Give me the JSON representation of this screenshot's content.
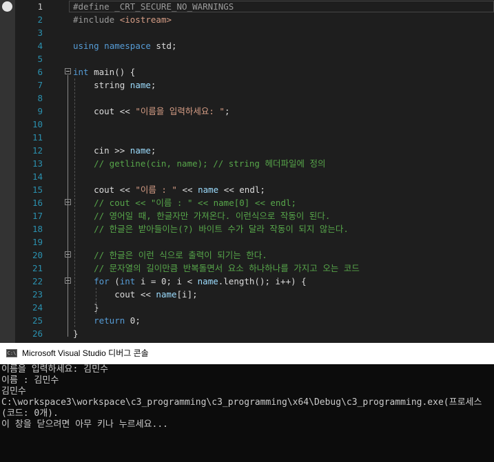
{
  "editor": {
    "lines": [
      {
        "num": "1",
        "segments": [
          {
            "t": "#define _CRT_SECURE_NO_WARNINGS",
            "c": "pp"
          }
        ]
      },
      {
        "num": "2",
        "segments": [
          {
            "t": "#include ",
            "c": "pp"
          },
          {
            "t": "<iostream>",
            "c": "str"
          }
        ]
      },
      {
        "num": "3",
        "segments": []
      },
      {
        "num": "4",
        "segments": [
          {
            "t": "using",
            "c": "kw"
          },
          {
            "t": " ",
            "c": ""
          },
          {
            "t": "namespace",
            "c": "kw"
          },
          {
            "t": " std;",
            "c": ""
          }
        ]
      },
      {
        "num": "5",
        "segments": []
      },
      {
        "num": "6",
        "segments": [
          {
            "t": "int",
            "c": "kw"
          },
          {
            "t": " main() {",
            "c": ""
          }
        ]
      },
      {
        "num": "7",
        "segments": [
          {
            "t": "    string ",
            "c": "id"
          },
          {
            "t": "name",
            "c": "var"
          },
          {
            "t": ";",
            "c": ""
          }
        ]
      },
      {
        "num": "8",
        "segments": []
      },
      {
        "num": "9",
        "segments": [
          {
            "t": "    cout << ",
            "c": ""
          },
          {
            "t": "\"이름을 입력하세요: \"",
            "c": "str"
          },
          {
            "t": ";",
            "c": ""
          }
        ]
      },
      {
        "num": "10",
        "segments": []
      },
      {
        "num": "11",
        "segments": []
      },
      {
        "num": "12",
        "segments": [
          {
            "t": "    cin >> ",
            "c": ""
          },
          {
            "t": "name",
            "c": "var"
          },
          {
            "t": ";",
            "c": ""
          }
        ]
      },
      {
        "num": "13",
        "segments": [
          {
            "t": "    // getline(cin, name); // string 헤더파일에 정의",
            "c": "cm"
          }
        ]
      },
      {
        "num": "14",
        "segments": []
      },
      {
        "num": "15",
        "segments": [
          {
            "t": "    cout << ",
            "c": ""
          },
          {
            "t": "\"이름 : \"",
            "c": "str"
          },
          {
            "t": " << ",
            "c": ""
          },
          {
            "t": "name",
            "c": "var"
          },
          {
            "t": " << endl;",
            "c": ""
          }
        ]
      },
      {
        "num": "16",
        "segments": [
          {
            "t": "    // cout << \"이름 : \" << name[0] << endl;",
            "c": "cm"
          }
        ]
      },
      {
        "num": "17",
        "segments": [
          {
            "t": "    // 영어일 때, 한글자만 가져온다. 이런식으로 작동이 된다.",
            "c": "cm"
          }
        ]
      },
      {
        "num": "18",
        "segments": [
          {
            "t": "    // 한글은 받아들이는(?) 바이트 수가 달라 작동이 되지 않는다.",
            "c": "cm"
          }
        ]
      },
      {
        "num": "19",
        "segments": []
      },
      {
        "num": "20",
        "segments": [
          {
            "t": "    // 한글은 이런 식으로 출력이 되기는 한다.",
            "c": "cm"
          }
        ]
      },
      {
        "num": "21",
        "segments": [
          {
            "t": "    // 문자열의 길이만큼 반복돌면서 요소 하나하나를 가지고 오는 코드",
            "c": "cm"
          }
        ]
      },
      {
        "num": "22",
        "segments": [
          {
            "t": "    for",
            "c": "kw"
          },
          {
            "t": " (",
            "c": ""
          },
          {
            "t": "int",
            "c": "kw"
          },
          {
            "t": " i = 0; i < ",
            "c": ""
          },
          {
            "t": "name",
            "c": "var"
          },
          {
            "t": ".length(); i++) {",
            "c": ""
          }
        ]
      },
      {
        "num": "23",
        "segments": [
          {
            "t": "        cout << ",
            "c": ""
          },
          {
            "t": "name",
            "c": "var"
          },
          {
            "t": "[i];",
            "c": ""
          }
        ]
      },
      {
        "num": "24",
        "segments": [
          {
            "t": "    }",
            "c": ""
          }
        ]
      },
      {
        "num": "25",
        "segments": [
          {
            "t": "    return",
            "c": "kw"
          },
          {
            "t": " 0;",
            "c": ""
          }
        ]
      },
      {
        "num": "26",
        "segments": [
          {
            "t": "}",
            "c": ""
          }
        ]
      }
    ]
  },
  "console": {
    "title": "Microsoft Visual Studio 디버그 콘솔",
    "icon": "console-app-icon",
    "icon_text": "C:\\",
    "lines": [
      "이름을 입력하세요: 김민수",
      "이름 : 김민수",
      "김민수",
      "C:\\workspace3\\workspace\\c3_programming\\c3_programming\\x64\\Debug\\c3_programming.exe(프로세스",
      "(코드: 0개).",
      "이 창을 닫으려면 아무 키나 누르세요..."
    ]
  }
}
